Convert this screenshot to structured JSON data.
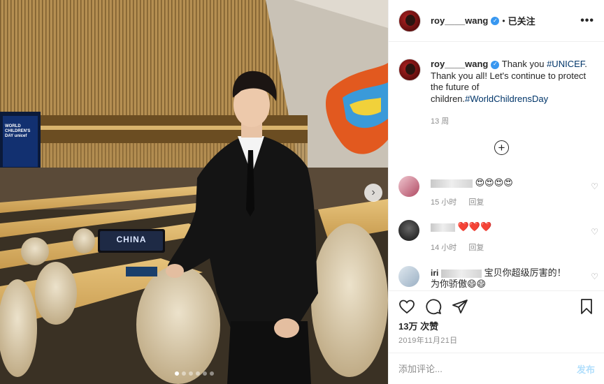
{
  "post": {
    "photo": {
      "sign_text": "CHINA",
      "screen_text": "WORLD CHILDREN'S DAY unicef",
      "slide_count": 6,
      "active_slide": 1
    },
    "header": {
      "username": "roy____wang",
      "separator": "•",
      "follow_label": "已关注",
      "more_glyph": "•••"
    },
    "caption": {
      "username": "roy____wang",
      "text_pre": " Thank you ",
      "tag1": "#UNICEF",
      "text_mid": ". Thank you all! Let's continue to protect the future of children.",
      "tag2": "#WorldChildrensDay",
      "time": "13 周"
    },
    "comments": [
      {
        "emoji": "😍😍😍😍",
        "time": "15 小时",
        "reply": "回复"
      },
      {
        "emoji": "❤️❤️❤️",
        "time": "14 小时",
        "reply": "回复"
      },
      {
        "name": "iri",
        "text": "宝贝你超级厉害的！为你骄傲😄😄"
      }
    ],
    "likes": "13万 次赞",
    "date": "2019年11月21日",
    "add_comment_placeholder": "添加评论...",
    "post_label": "发布",
    "colors": {
      "link": "#003569",
      "verified": "#3897f0",
      "muted": "#8e8e8e",
      "post_disabled": "#b2dffc"
    }
  }
}
